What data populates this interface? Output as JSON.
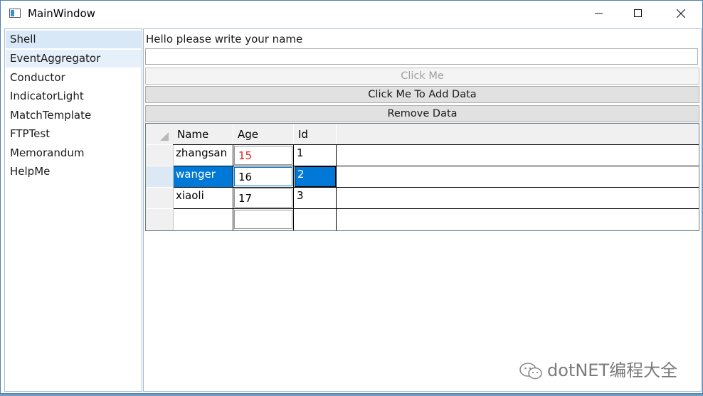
{
  "window": {
    "title": "MainWindow"
  },
  "sidebar": {
    "items": [
      {
        "label": "Shell"
      },
      {
        "label": "EventAggregator"
      },
      {
        "label": "Conductor"
      },
      {
        "label": "IndicatorLight"
      },
      {
        "label": "MatchTemplate"
      },
      {
        "label": "FTPTest"
      },
      {
        "label": "Memorandum"
      },
      {
        "label": "HelpMe"
      }
    ]
  },
  "main": {
    "prompt": "Hello please write your name",
    "name_value": "",
    "buttons": {
      "click_me": "Click Me",
      "add_data": "Click Me To Add Data",
      "remove_data": "Remove Data"
    },
    "grid": {
      "columns": [
        "Name",
        "Age",
        "Id"
      ],
      "rows": [
        {
          "name": "zhangsan",
          "age": "15",
          "id": "1"
        },
        {
          "name": "wanger",
          "age": "16",
          "id": "2"
        },
        {
          "name": "xiaoli",
          "age": "17",
          "id": "3"
        },
        {
          "name": "",
          "age": "",
          "id": ""
        }
      ],
      "selected_row": 1,
      "age_highlight_color": "#e0201b",
      "selection_color": "#0078d7"
    }
  },
  "watermark": {
    "text": "dotNET编程大全"
  }
}
